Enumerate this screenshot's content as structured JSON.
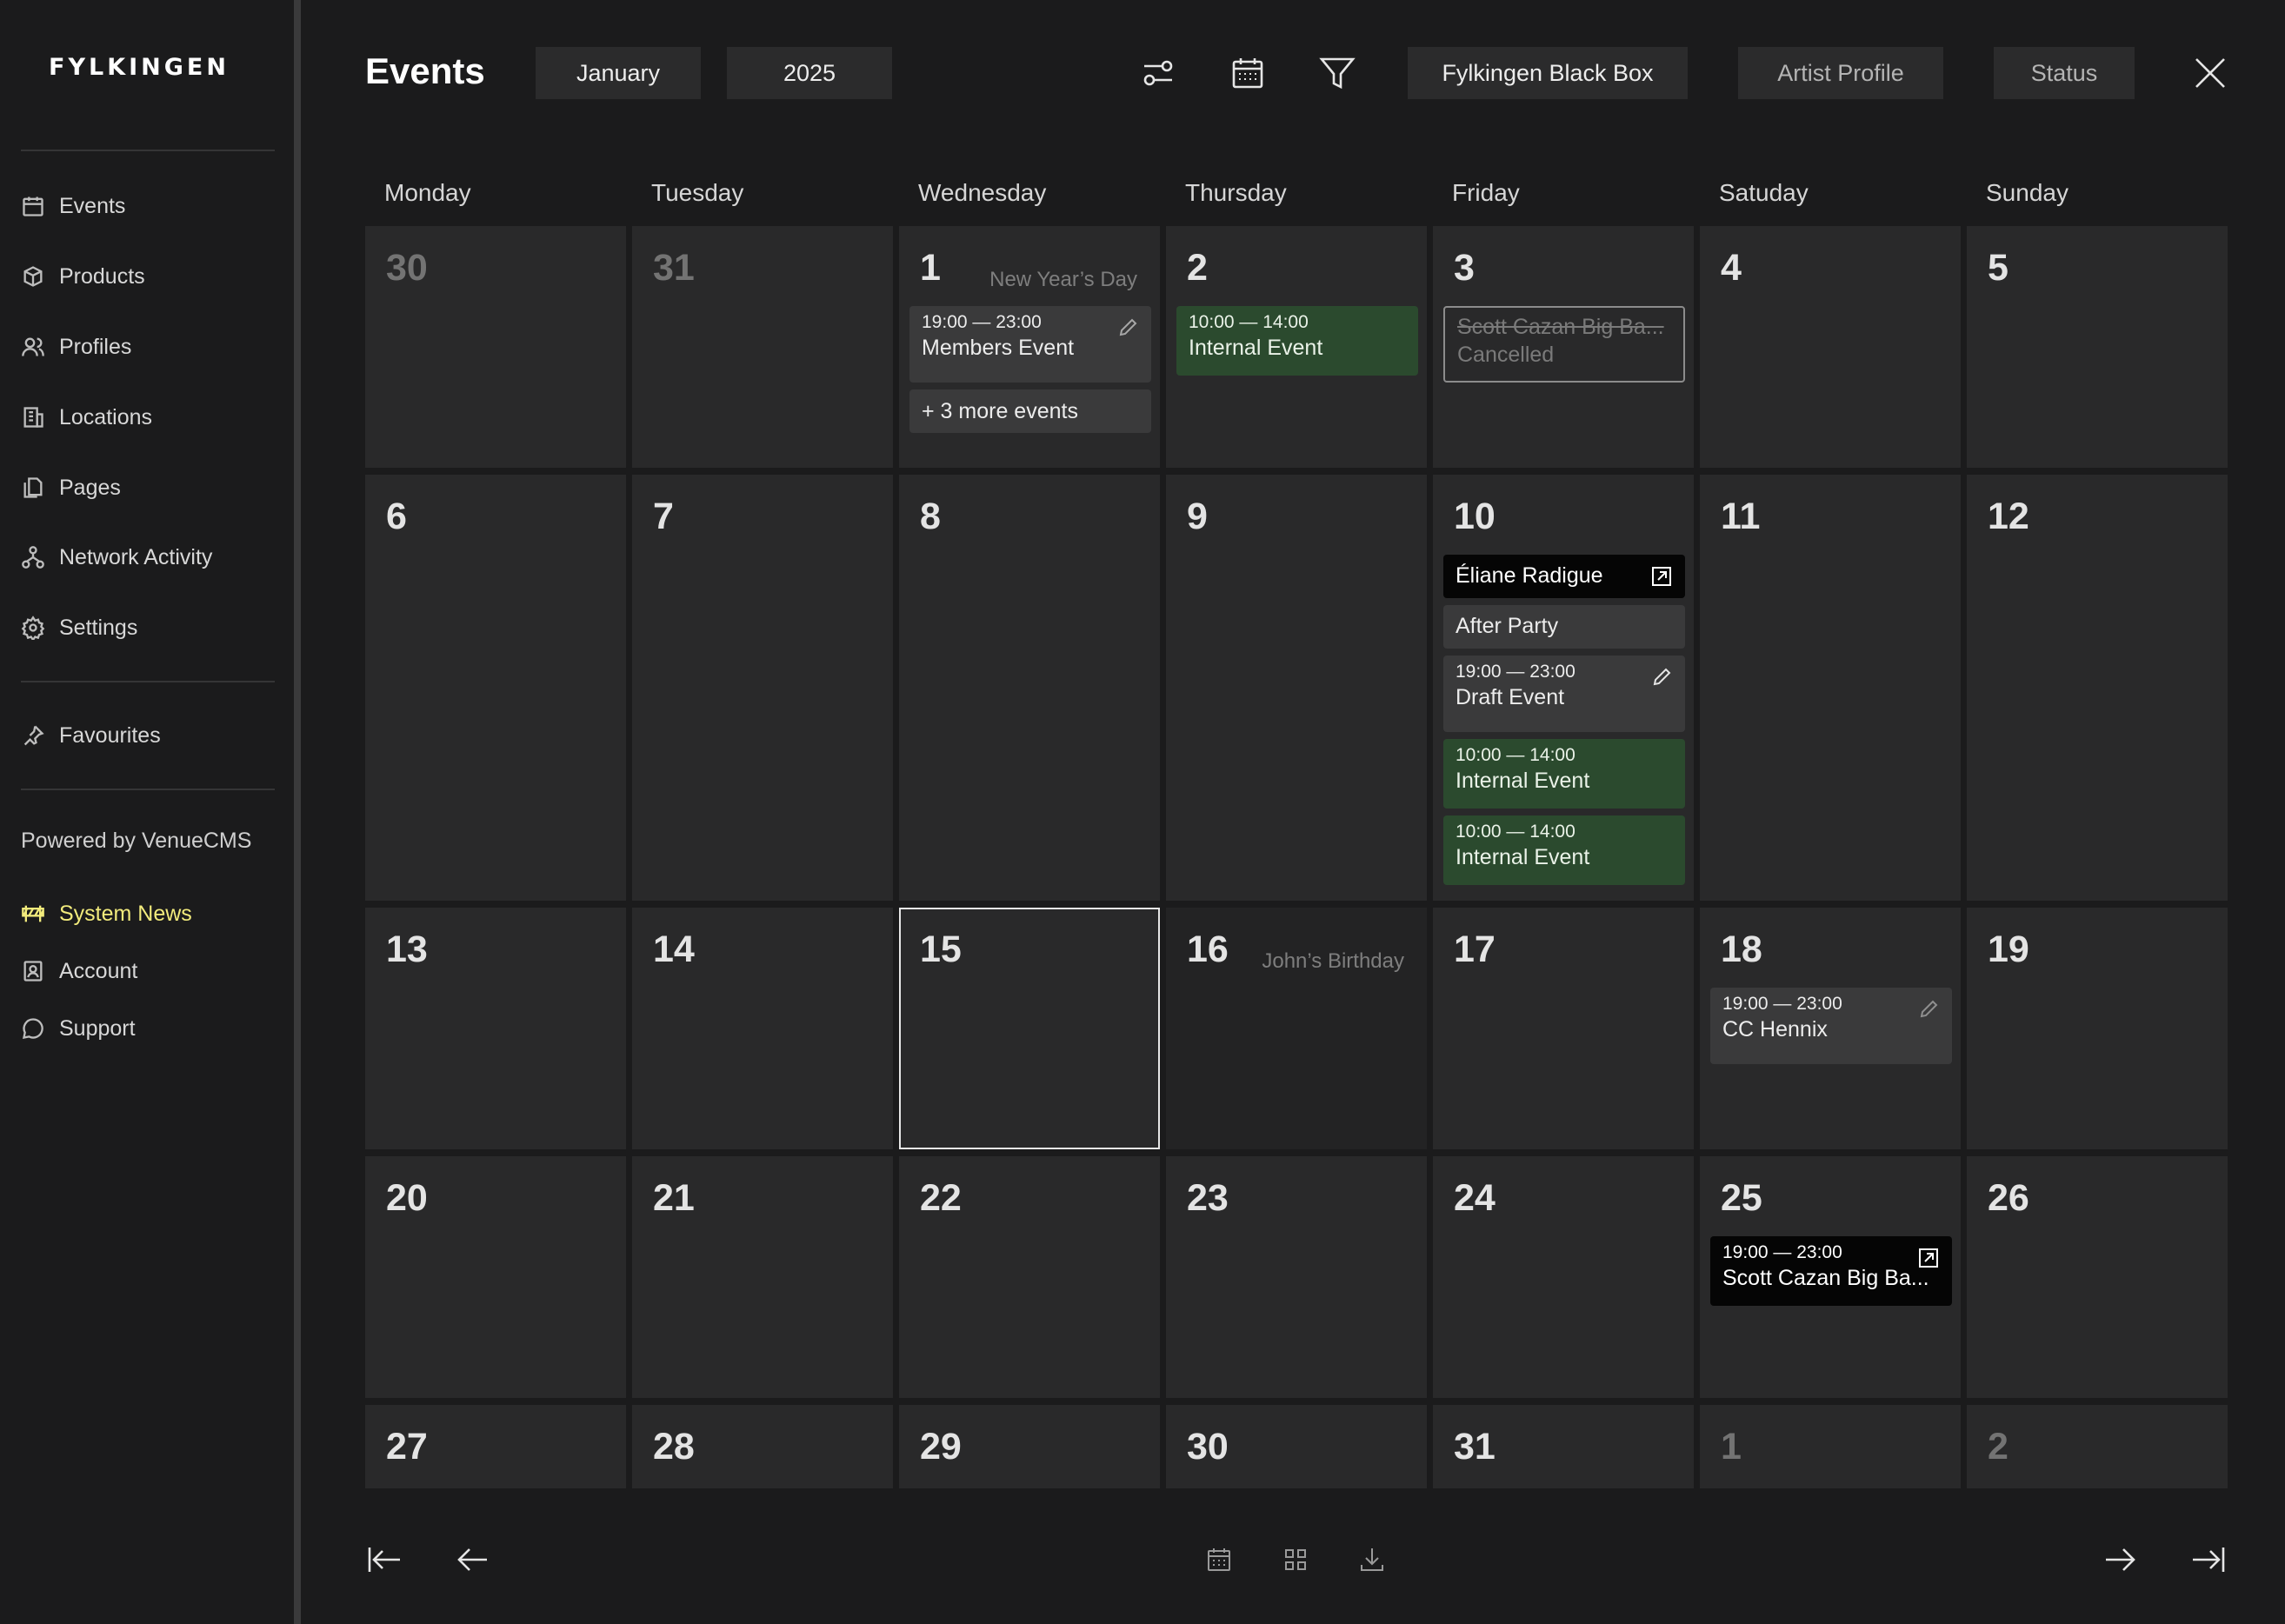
{
  "sidebar": {
    "logo": "FYLKINGEN",
    "items": [
      {
        "label": "Events",
        "icon": "calendar-icon"
      },
      {
        "label": "Products",
        "icon": "box-icon"
      },
      {
        "label": "Profiles",
        "icon": "users-icon"
      },
      {
        "label": "Locations",
        "icon": "building-icon"
      },
      {
        "label": "Pages",
        "icon": "pages-icon"
      },
      {
        "label": "Network Activity",
        "icon": "network-icon"
      },
      {
        "label": "Settings",
        "icon": "gear-icon"
      }
    ],
    "favourites": "Favourites",
    "powered_by": "Powered by VenueCMS",
    "bottom_items": [
      {
        "label": "System News",
        "icon": "barrier-icon",
        "color": "#f2eb7c"
      },
      {
        "label": "Account",
        "icon": "account-icon"
      },
      {
        "label": "Support",
        "icon": "chat-icon"
      }
    ]
  },
  "header": {
    "title": "Events",
    "month": "January",
    "year": "2025",
    "venue": "Fylkingen Black Box",
    "artist_filter": "Artist Profile",
    "status_filter": "Status"
  },
  "weekdays": [
    "Monday",
    "Tuesday",
    "Wednesday",
    "Thursday",
    "Friday",
    "Satuday",
    "Sunday"
  ],
  "days": {
    "r0": [
      "30",
      "31",
      "1",
      "2",
      "3",
      "4",
      "5"
    ],
    "r1": [
      "6",
      "7",
      "8",
      "9",
      "10",
      "11",
      "12"
    ],
    "r2": [
      "13",
      "14",
      "15",
      "16",
      "17",
      "18",
      "19"
    ],
    "r3": [
      "20",
      "21",
      "22",
      "23",
      "24",
      "25",
      "26"
    ],
    "r4": [
      "27",
      "28",
      "29",
      "30",
      "31",
      "1",
      "2"
    ]
  },
  "holidays": {
    "jan1": "New Year’s Day",
    "jan16": "John’s Birthday"
  },
  "events": {
    "jan1_members": {
      "time": "19:00 — 23:00",
      "title": "Members Event"
    },
    "jan1_more": "+ 3 more events",
    "jan2_internal": {
      "time": "10:00 — 14:00",
      "title": "Internal Event"
    },
    "jan3_cancelled": {
      "title": "Scott Cazan Big Ba...",
      "status": "Cancelled"
    },
    "jan10_eliane": {
      "title": "Éliane Radigue"
    },
    "jan10_afterparty": {
      "title": "After Party"
    },
    "jan10_draft": {
      "time": "19:00 — 23:00",
      "title": "Draft Event"
    },
    "jan10_internal1": {
      "time": "10:00 — 14:00",
      "title": "Internal Event"
    },
    "jan10_internal2": {
      "time": "10:00 — 14:00",
      "title": "Internal Event"
    },
    "jan18_hennix": {
      "time": "19:00 — 23:00",
      "title": "CC Hennix"
    },
    "jan25_scott": {
      "time": "19:00 — 23:00",
      "title": "Scott Cazan Big Ba..."
    }
  },
  "colors": {
    "event_green": "#2b4a2e",
    "event_gray": "#3a3a3b",
    "event_black": "#050505",
    "accent_yellow": "#f2eb7c"
  }
}
